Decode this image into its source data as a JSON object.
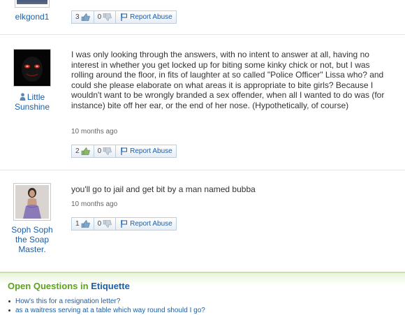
{
  "answers": [
    {
      "username": "elkgond1",
      "votes_up": "3",
      "votes_down": "0",
      "report_label": "Report Abuse"
    },
    {
      "username": "Little Sunshine",
      "text": "I was only looking through the answers, with no intent to answer at all, having no interest in whether you get locked up for biting some kinky chick or not, but I was rolling around the floor, in fits of laughter at so called \"Police Officer\" Lissa who? and could she please elaborate on what areas it is appropriate to bite girls? Because I wouldn't want to be wrongly branded a sex offender, when all I wanted to do was (for instance) bite off her ear, or the end of her nose. (Hypothetically, of course)",
      "time": "10 months ago",
      "votes_up": "2",
      "votes_down": "0",
      "report_label": "Report Abuse"
    },
    {
      "username": "Soph Soph the Soap Master.",
      "text": "you'll go to jail and get bit by a man named bubba",
      "time": "10 months ago",
      "votes_up": "1",
      "votes_down": "0",
      "report_label": "Report Abuse"
    }
  ],
  "open_questions": {
    "title_prefix": "Open Questions in",
    "category": "Etiquette",
    "items": [
      "How's this for a resignation letter?",
      "as a waitress serving at a table which way round should I go?"
    ]
  },
  "colors": {
    "link": "#1b5fa6",
    "green": "#5ca21b",
    "text": "#333333"
  },
  "icons": [
    "thumbs-up-icon",
    "thumbs-down-icon",
    "flag-icon",
    "person-icon"
  ]
}
